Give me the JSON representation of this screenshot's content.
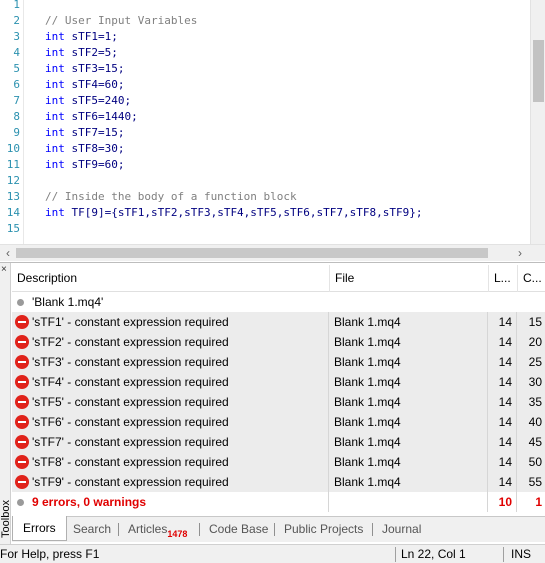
{
  "editor": {
    "line_numbers": [
      "1",
      "2",
      "3",
      "4",
      "5",
      "6",
      "7",
      "8",
      "9",
      "10",
      "11",
      "12",
      "13",
      "14",
      "15"
    ],
    "comment1": "// User Input Variables",
    "decls": [
      {
        "kw": "int",
        "rest": " sTF1=1;"
      },
      {
        "kw": "int",
        "rest": " sTF2=5;"
      },
      {
        "kw": "int",
        "rest": " sTF3=15;"
      },
      {
        "kw": "int",
        "rest": " sTF4=60;"
      },
      {
        "kw": "int",
        "rest": " sTF5=240;"
      },
      {
        "kw": "int",
        "rest": " sTF6=1440;"
      },
      {
        "kw": "int",
        "rest": " sTF7=15;"
      },
      {
        "kw": "int",
        "rest": " sTF8=30;"
      },
      {
        "kw": "int",
        "rest": " sTF9=60;"
      }
    ],
    "comment2": "// Inside the body of a function block",
    "array_kw": "int",
    "array_rest": " TF[9]={sTF1,sTF2,sTF3,sTF4,sTF5,sTF6,sTF7,sTF8,sTF9};",
    "colors": {
      "keyword": "#0000ff",
      "comment": "#808080",
      "code": "#000080",
      "line_number": "#2b91af"
    }
  },
  "toolbox": {
    "label": "Toolbox",
    "close_glyph": "×",
    "columns": {
      "description": "Description",
      "file": "File",
      "line": "L...",
      "column": "C..."
    },
    "header_row": {
      "description": "'Blank 1.mq4'"
    },
    "errors": [
      {
        "description": "'sTF1' - constant expression required",
        "file": "Blank 1.mq4",
        "line": "14",
        "column": "15"
      },
      {
        "description": "'sTF2' - constant expression required",
        "file": "Blank 1.mq4",
        "line": "14",
        "column": "20"
      },
      {
        "description": "'sTF3' - constant expression required",
        "file": "Blank 1.mq4",
        "line": "14",
        "column": "25"
      },
      {
        "description": "'sTF4' - constant expression required",
        "file": "Blank 1.mq4",
        "line": "14",
        "column": "30"
      },
      {
        "description": "'sTF5' - constant expression required",
        "file": "Blank 1.mq4",
        "line": "14",
        "column": "35"
      },
      {
        "description": "'sTF6' - constant expression required",
        "file": "Blank 1.mq4",
        "line": "14",
        "column": "40"
      },
      {
        "description": "'sTF7' - constant expression required",
        "file": "Blank 1.mq4",
        "line": "14",
        "column": "45"
      },
      {
        "description": "'sTF8' - constant expression required",
        "file": "Blank 1.mq4",
        "line": "14",
        "column": "50"
      },
      {
        "description": "'sTF9' - constant expression required",
        "file": "Blank 1.mq4",
        "line": "14",
        "column": "55"
      }
    ],
    "summary": {
      "description": "9 errors, 0 warnings",
      "line": "10",
      "column": "1"
    },
    "tabs": {
      "errors": "Errors",
      "search": "Search",
      "articles": "Articles",
      "articles_badge": "1478",
      "codebase": "Code Base",
      "public_projects": "Public Projects",
      "journal": "Journal"
    },
    "colors": {
      "error": "#e00000",
      "error_icon": "#e0231b"
    }
  },
  "statusbar": {
    "help": "For Help, press F1",
    "position": "Ln 22, Col 1",
    "mode": "INS"
  }
}
